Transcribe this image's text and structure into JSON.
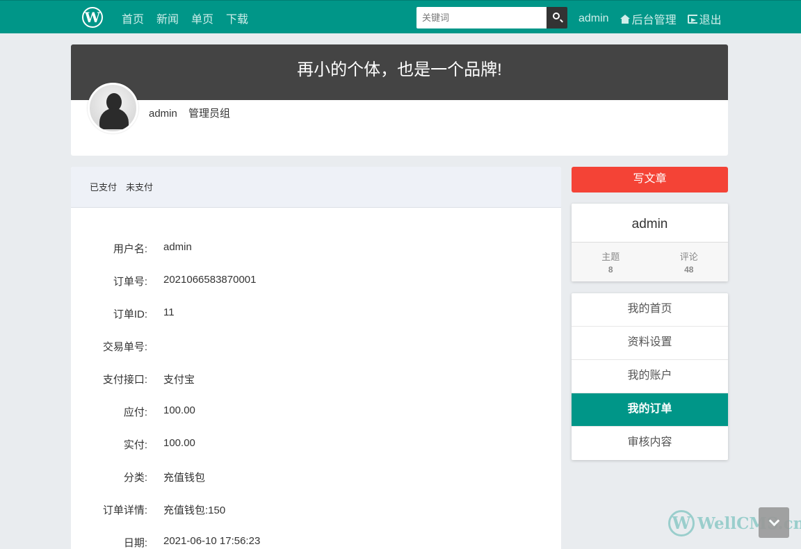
{
  "nav": {
    "logo": "W",
    "links": [
      "首页",
      "新闻",
      "单页",
      "下载"
    ],
    "search_placeholder": "关键词",
    "username": "admin",
    "admin_label": "后台管理",
    "logout_label": "退出"
  },
  "banner": {
    "slogan": "再小的个体，也是一个品牌!",
    "username": "admin",
    "group": "管理员组"
  },
  "tabs": [
    "已支付",
    "未支付"
  ],
  "order": [
    {
      "label": "用户名:",
      "value": "admin"
    },
    {
      "label": "订单号:",
      "value": "2021066583870001"
    },
    {
      "label": "订单ID:",
      "value": "11"
    },
    {
      "label": "交易单号:",
      "value": ""
    },
    {
      "label": "支付接口:",
      "value": "支付宝"
    },
    {
      "label": "应付:",
      "value": "100.00"
    },
    {
      "label": "实付:",
      "value": "100.00"
    },
    {
      "label": "分类:",
      "value": "充值钱包"
    },
    {
      "label": "订单详情:",
      "value": "充值钱包:150"
    },
    {
      "label": "日期:",
      "value": "2021-06-10 17:56:23"
    }
  ],
  "sidebar": {
    "write_label": "写文章",
    "username": "admin",
    "stats": [
      {
        "label": "主题",
        "value": "8"
      },
      {
        "label": "评论",
        "value": "48"
      }
    ],
    "menu": [
      {
        "label": "我的首页",
        "active": false
      },
      {
        "label": "资料设置",
        "active": false
      },
      {
        "label": "我的账户",
        "active": false
      },
      {
        "label": "我的订单",
        "active": true
      },
      {
        "label": "审核内容",
        "active": false
      }
    ]
  },
  "watermark": {
    "logo": "W",
    "text": "WellCMS.cn"
  },
  "colors": {
    "primary": "#009688",
    "danger": "#f44336",
    "banner_dark": "#444444"
  }
}
